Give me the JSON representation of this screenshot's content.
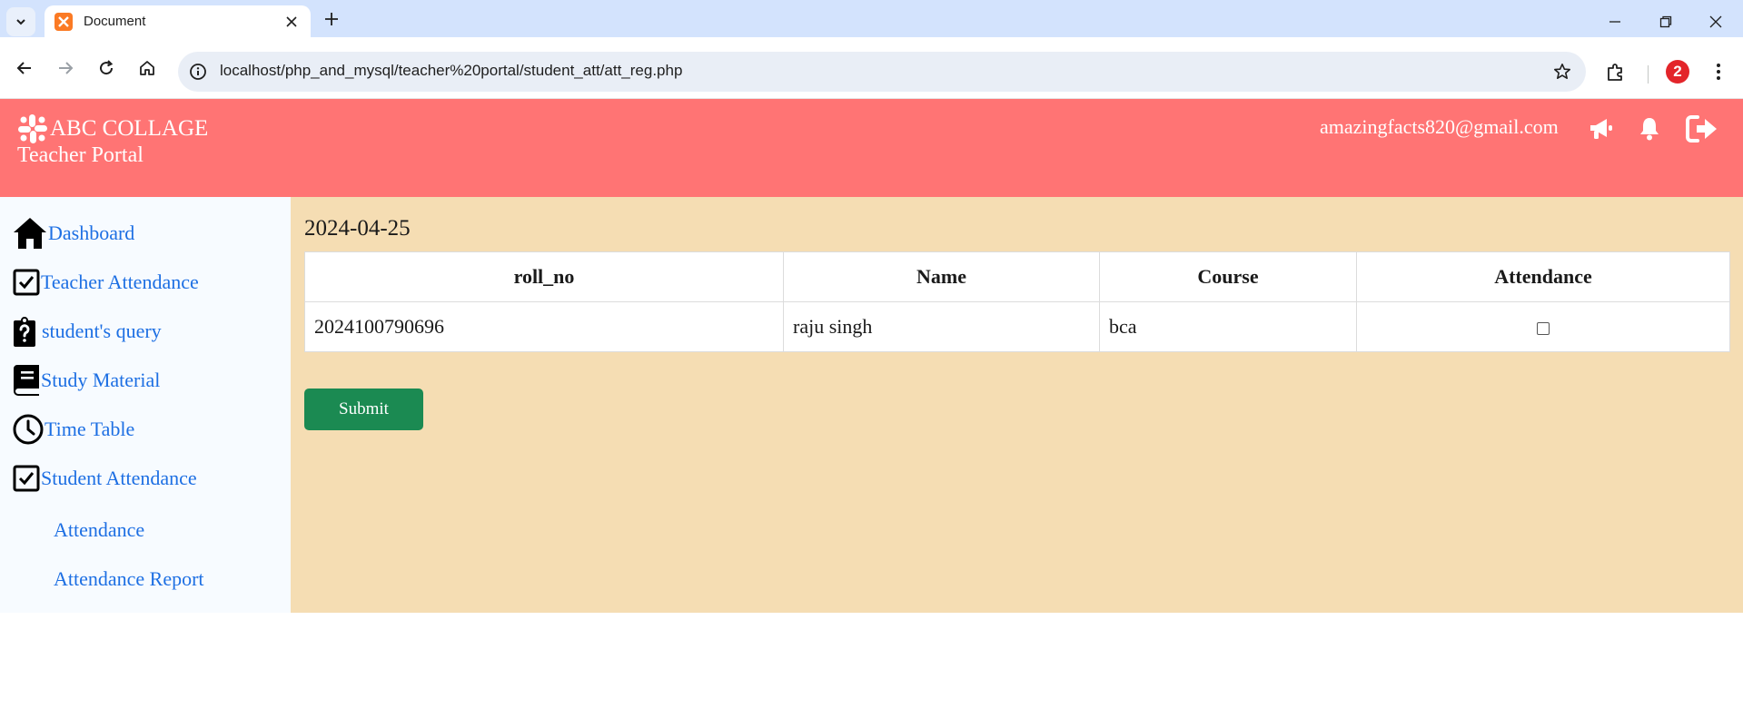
{
  "browser": {
    "tab_title": "Document",
    "url": "localhost/php_and_mysql/teacher%20portal/student_att/att_reg.php",
    "profile_badge": "2"
  },
  "header": {
    "brand_name": "ABC COLLAGE",
    "brand_sub": "Teacher Portal",
    "user_email": "amazingfacts820@gmail.com",
    "bg_color": "#ff7474"
  },
  "sidebar": {
    "items": [
      {
        "label": "Dashboard",
        "icon": "home-icon"
      },
      {
        "label": "Teacher Attendance",
        "icon": "checkbox-icon"
      },
      {
        "label": "student's query",
        "icon": "clipboard-question-icon"
      },
      {
        "label": "Study Material",
        "icon": "book-icon"
      },
      {
        "label": "Time Table",
        "icon": "clock-icon"
      },
      {
        "label": "Student Attendance",
        "icon": "checkbox-icon"
      }
    ],
    "sub_items": [
      {
        "label": "Attendance"
      },
      {
        "label": "Attendance Report"
      }
    ],
    "link_color": "#1d6fe3"
  },
  "main": {
    "date": "2024-04-25",
    "table": {
      "headers": [
        "roll_no",
        "Name",
        "Course",
        "Attendance"
      ],
      "rows": [
        {
          "roll_no": "2024100790696",
          "name": "raju singh",
          "course": "bca",
          "attendance_checked": false
        }
      ]
    },
    "submit_label": "Submit",
    "bg_color": "#f5ddb3",
    "button_color": "#1b8a52"
  }
}
